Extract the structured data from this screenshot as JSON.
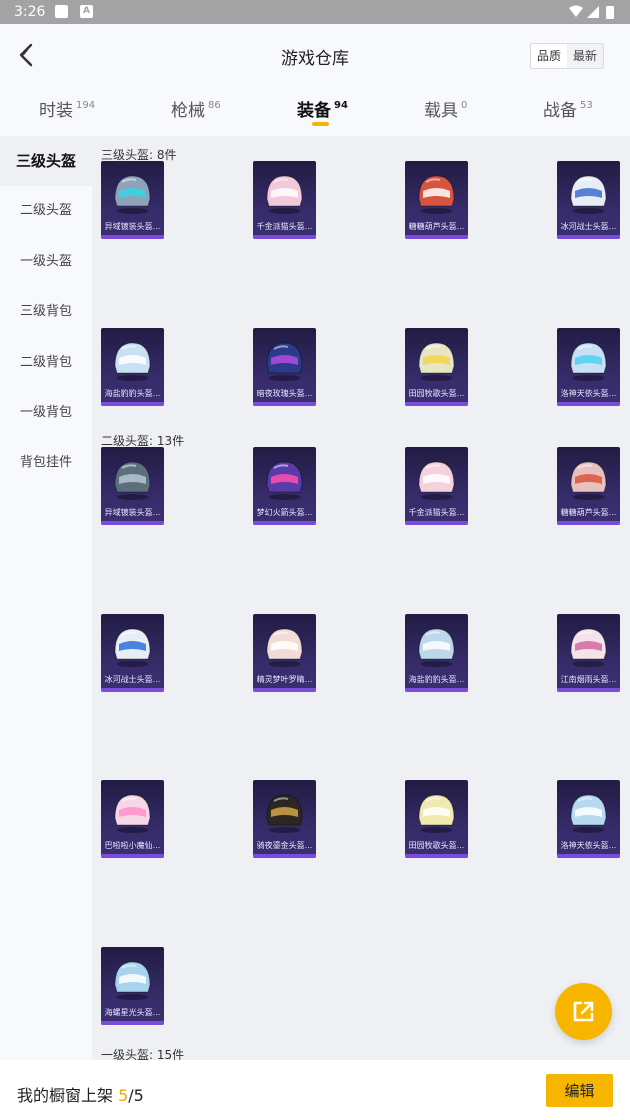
{
  "status_bar": {
    "time": "3:26",
    "notif_letter": "A"
  },
  "header": {
    "title": "游戏仓库",
    "sort_quality": "品质",
    "sort_newest": "最新"
  },
  "tabs": [
    {
      "label": "时装",
      "count": "194"
    },
    {
      "label": "枪械",
      "count": "86"
    },
    {
      "label": "装备",
      "count": "94"
    },
    {
      "label": "载具",
      "count": "0"
    },
    {
      "label": "战备",
      "count": "53"
    }
  ],
  "sidebar": [
    "三级头盔",
    "二级头盔",
    "一级头盔",
    "三级背包",
    "二级背包",
    "一级背包",
    "背包挂件"
  ],
  "sections": [
    {
      "title": "三级头盔: 8件",
      "items": [
        {
          "label": "异域镀装头盔...",
          "color": "#8fa3b8",
          "accent": "#33d6e8"
        },
        {
          "label": "千金派猫头盔...",
          "color": "#f2c9d8",
          "accent": "#ffffff"
        },
        {
          "label": "糖糖葫芦头盔...",
          "color": "#d6553e",
          "accent": "#ffffff"
        },
        {
          "label": "冰河战士头盔...",
          "color": "#e8eef6",
          "accent": "#3b6fd1"
        },
        {
          "label": "海盐豹豹头盔...",
          "color": "#c9e2f2",
          "accent": "#ffffff"
        },
        {
          "label": "暗夜玫瑰头盔...",
          "color": "#2c3a8a",
          "accent": "#b24ce0"
        },
        {
          "label": "田园牧歌头盔...",
          "color": "#e6e6c4",
          "accent": "#f3d34a"
        },
        {
          "label": "洛神天依头盔...",
          "color": "#c8e0f4",
          "accent": "#4fd0f0"
        }
      ]
    },
    {
      "title": "二级头盔: 13件",
      "items": [
        {
          "label": "异域镀装头盔...",
          "color": "#5c6f7d",
          "accent": "#b9c7d0"
        },
        {
          "label": "梦幻火箭头盔...",
          "color": "#5a3ca8",
          "accent": "#ff4fb0"
        },
        {
          "label": "千金派猫头盔...",
          "color": "#f4d2dc",
          "accent": "#ffffff"
        },
        {
          "label": "糖糖葫芦头盔...",
          "color": "#e7c1bd",
          "accent": "#d9553f"
        },
        {
          "label": "冰河战士头盔...",
          "color": "#e8eef6",
          "accent": "#2f6fd8"
        },
        {
          "label": "精灵梦叶罗睛...",
          "color": "#f2dcd8",
          "accent": "#ffffff"
        },
        {
          "label": "海盐豹豹头盔...",
          "color": "#bcd8ea",
          "accent": "#ffffff"
        },
        {
          "label": "江南烟雨头盔...",
          "color": "#f4e3ea",
          "accent": "#d46aa0"
        },
        {
          "label": "巴啦啦小魔仙...",
          "color": "#f6d7e6",
          "accent": "#ff8fc8"
        },
        {
          "label": "骑夜鎏金头盔...",
          "color": "#2d2621",
          "accent": "#d2a64a"
        },
        {
          "label": "田园牧歌头盔...",
          "color": "#f0eab0",
          "accent": "#ffffff"
        },
        {
          "label": "洛神天依头盔...",
          "color": "#b7d9ef",
          "accent": "#ffffff"
        },
        {
          "label": "海螺星光头盔...",
          "color": "#a8d3ef",
          "accent": "#ffffff"
        }
      ]
    },
    {
      "title": "一级头盔: 15件",
      "items": []
    }
  ],
  "bottom_bar": {
    "prefix": "我的橱窗上架 ",
    "current": "5",
    "slash": "/",
    "total": "5",
    "edit_label": "编辑"
  },
  "colors": {
    "accent": "#f7b500",
    "card_bg": "#2a2355",
    "card_bar": "#7a4cdb"
  },
  "icons": {
    "back": "chevron-left-icon",
    "share": "external-link-icon"
  }
}
